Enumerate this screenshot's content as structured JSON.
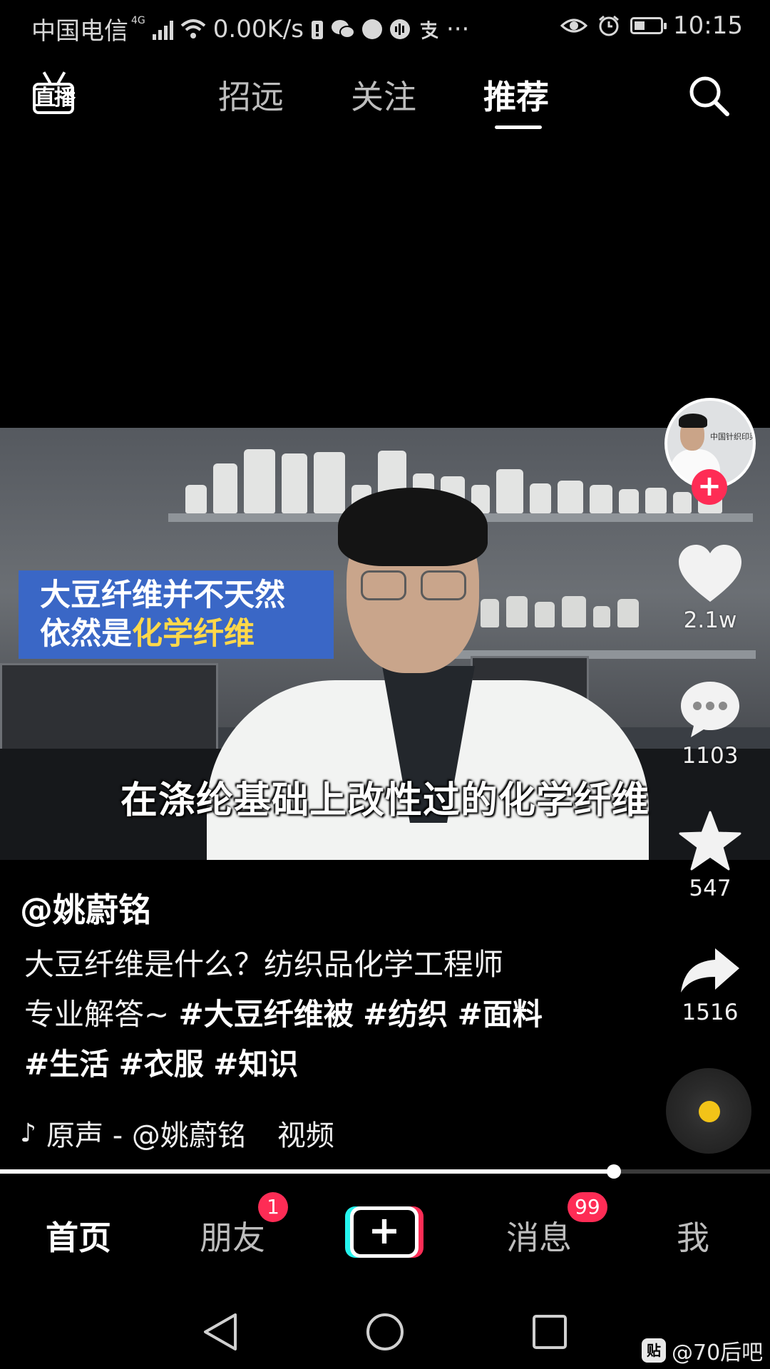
{
  "status_bar": {
    "carrier": "中国电信",
    "network": "4G",
    "speed": "0.00K/s",
    "more": "···",
    "time": "10:15",
    "icons": [
      "signal-icon",
      "wifi-icon",
      "battery-alert-icon",
      "wechat-icon",
      "app-icon",
      "soundwave-icon",
      "alipay-icon",
      "eye-icon",
      "alarm-icon",
      "battery-icon"
    ]
  },
  "top_nav": {
    "live_label": "直播",
    "tabs": [
      {
        "label": "招远"
      },
      {
        "label": "关注"
      },
      {
        "label": "推荐",
        "active": true
      }
    ]
  },
  "video": {
    "overlay_line1": "大豆纤维并不天然",
    "overlay_line2_prefix": "依然是",
    "overlay_line2_highlight": "化学纤维",
    "subtitle": "在涤纶基础上改性过的化学纤维",
    "avatar_text": "中国针织印染 eing & Printing Techn"
  },
  "actions": {
    "likes": "2.1w",
    "comments": "1103",
    "favorites": "547",
    "shares": "1516"
  },
  "caption": {
    "author": "@姚蔚铭",
    "desc_line1": "大豆纤维是什么？纺织品化学工程师",
    "desc_line2_prefix": "专业解答~ ",
    "tags_line2": [
      "#大豆纤维被",
      "#纺织",
      "#面料"
    ],
    "tags_line3": [
      "#生活",
      "#衣服",
      "#知识"
    ],
    "music": "原声 - @姚蔚铭",
    "music_extra": "视频"
  },
  "progress": {
    "fraction": 0.797
  },
  "bottom_tabs": [
    {
      "label": "首页",
      "active": true
    },
    {
      "label": "朋友",
      "badge": "1"
    },
    {
      "label": "+"
    },
    {
      "label": "消息",
      "badge": "99"
    },
    {
      "label": "我"
    }
  ],
  "watermark": {
    "icon_text": "贴",
    "text": "@70后吧"
  },
  "colors": {
    "accent_red": "#fe2c55",
    "accent_cyan": "#25f4ee",
    "overlay_blue": "#3a67c6",
    "overlay_yellow": "#ffd84a",
    "disc_dot": "#f2c318"
  }
}
